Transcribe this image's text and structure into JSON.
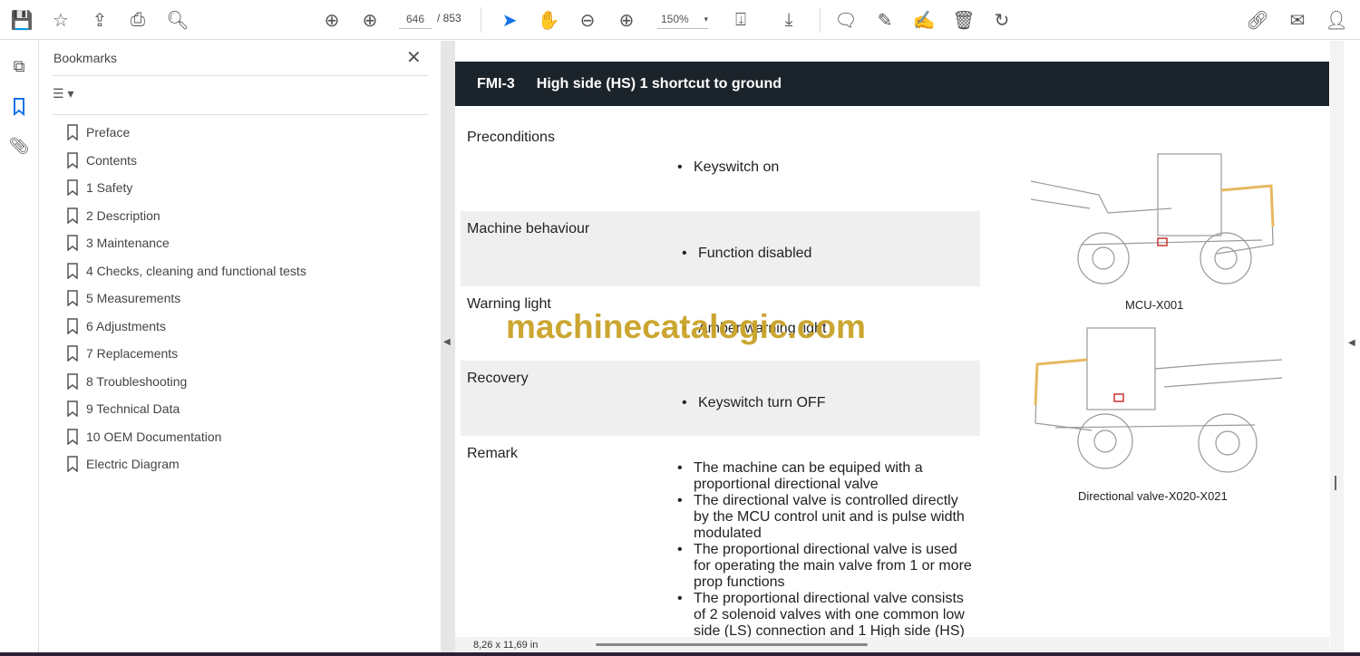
{
  "toolbar": {
    "page_current": "646",
    "page_total": "/ 853",
    "zoom": "150%"
  },
  "bookmarks": {
    "title": "Bookmarks",
    "items": [
      "Preface",
      "Contents",
      "1 Safety",
      "2 Description",
      "3 Maintenance",
      "4 Checks, cleaning and functional tests",
      "5 Measurements",
      "6 Adjustments",
      "7 Replacements",
      "8 Troubleshooting",
      "9 Technical Data",
      "10 OEM Documentation",
      "Electric Diagram"
    ]
  },
  "doc": {
    "code": "FMI-3",
    "title": "High side (HS) 1 shortcut to ground",
    "sections": [
      {
        "label": "Preconditions",
        "bullets": [
          "Keyswitch on"
        ]
      },
      {
        "label": "Machine behaviour",
        "bullets": [
          "Function disabled"
        ]
      },
      {
        "label": "Warning light",
        "bullets": [
          "Amber warning light"
        ]
      },
      {
        "label": "Recovery",
        "bullets": [
          "Keyswitch turn OFF"
        ]
      },
      {
        "label": "Remark",
        "bullets": [
          "The machine can be equiped with a proportional directional valve",
          "The directional valve is controlled directly by the MCU control unit and is pulse width modulated",
          "The proportional directional valve is used for operating the main valve from 1 or more prop functions",
          "The proportional directional valve consists of 2 solenoid valves with one common low side (LS) connection and 1 High side (HS)"
        ]
      }
    ],
    "figure1_caption": "MCU-X001",
    "figure2_caption": "Directional valve-X020-X021",
    "watermark": "machinecatalogic.com"
  },
  "status": {
    "page_size": "8,26 x 11,69 in"
  }
}
